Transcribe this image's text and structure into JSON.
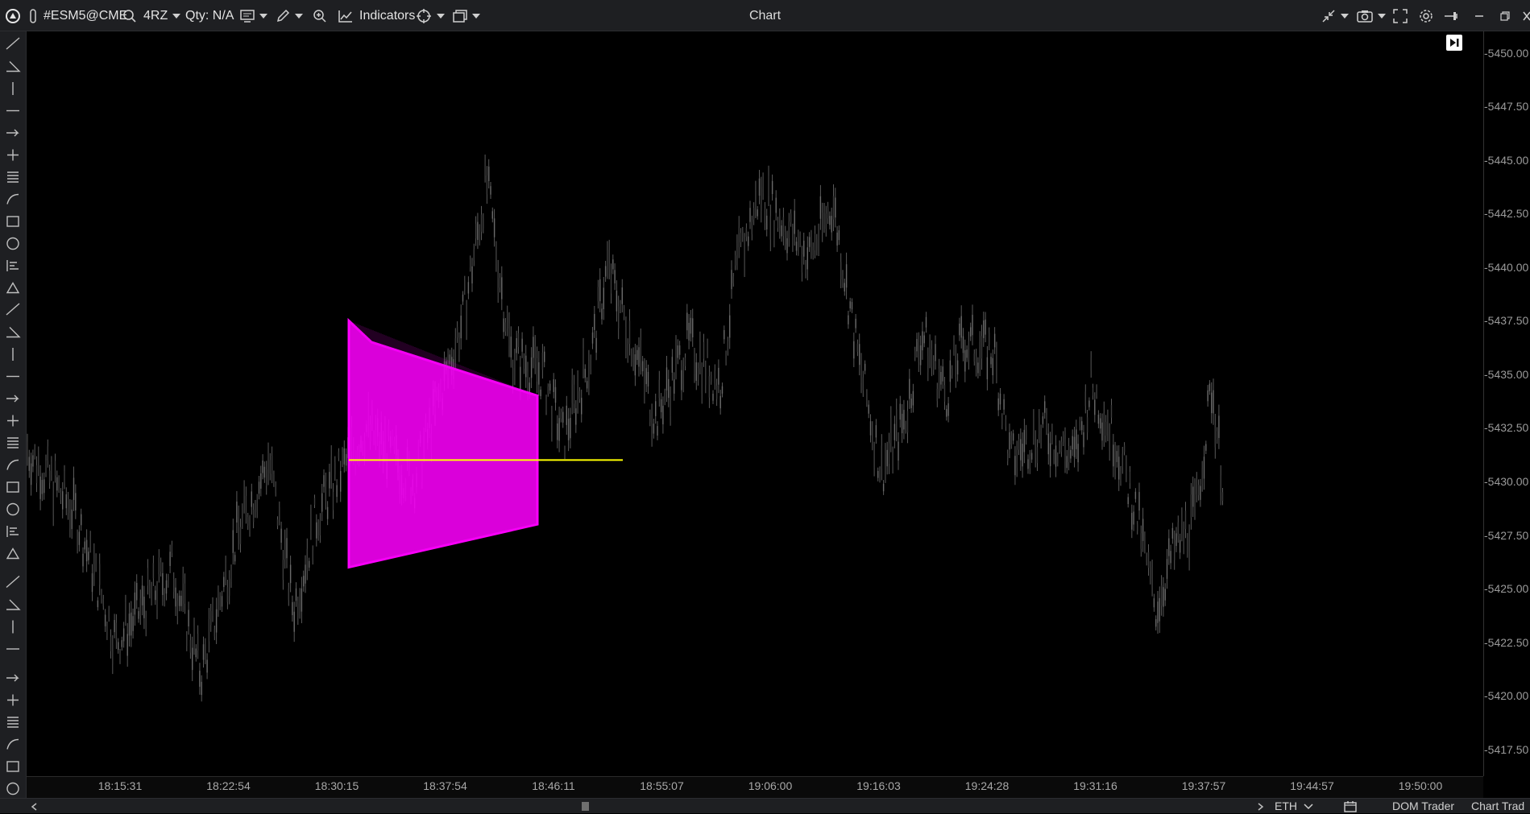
{
  "toolbar": {
    "symbol": "#ESM5@CME",
    "timeframe": "4RZ",
    "qty": "Qty: N/A",
    "indicators_label": "Indicators"
  },
  "window": {
    "title": "Chart"
  },
  "left_tools": [
    "drag-handle-icon",
    "line-tool-icon",
    "angle-tool-icon",
    "vertical-line-icon",
    "horizontal-ray-icon",
    "arrow-ray-icon",
    "crosshair-icon",
    "horizontal-lines-icon",
    "curve-tool-icon",
    "angle-fan-icon",
    "spiral-icon",
    "ruler-icon",
    "parallel-channel-icon",
    "triangle-icon",
    "rectangle-icon",
    "circle-icon",
    "fib-retracement-icon",
    "fib-extension-icon",
    "fib-levels-icon",
    "pitchfork-icon",
    "regression-icon",
    "gann-icon",
    "dotted-rect-icon",
    "dotted-vertical-icon",
    "text-tool-icon",
    "tag-icon",
    "label-icon",
    "callout-icon",
    "dot-marker-icon",
    "diamond-marker-icon",
    "square-marker-icon",
    "arrow-up-marker-icon",
    "arrow-down-marker-icon",
    "sort-icon"
  ],
  "chart": {
    "play_button": "jump-to-end-icon"
  },
  "chart_data": {
    "type": "candlestick",
    "symbol": "#ESM5@CME",
    "y_ticks": [
      "5450.00",
      "5447.50",
      "5445.00",
      "5442.50",
      "5440.00",
      "5437.50",
      "5435.00",
      "5432.50",
      "5430.00",
      "5427.50",
      "5425.00",
      "5422.50",
      "5420.00",
      "5417.50"
    ],
    "y_range": [
      5416.25,
      5451.0
    ],
    "x_ticks": [
      "18:15:31",
      "18:22:54",
      "18:30:15",
      "18:37:54",
      "18:46:11",
      "18:55:07",
      "19:06:00",
      "19:16:03",
      "19:24:28",
      "19:31:16",
      "19:37:57",
      "19:44:57",
      "19:50:00"
    ],
    "price_path": [
      {
        "x": 0,
        "y": 5431.5
      },
      {
        "x": 60,
        "y": 5428.5
      },
      {
        "x": 110,
        "y": 5422.5
      },
      {
        "x": 140,
        "y": 5424.0
      },
      {
        "x": 180,
        "y": 5426.0
      },
      {
        "x": 215,
        "y": 5421.0
      },
      {
        "x": 260,
        "y": 5427.5
      },
      {
        "x": 300,
        "y": 5431.0
      },
      {
        "x": 330,
        "y": 5424.0
      },
      {
        "x": 360,
        "y": 5428.5
      },
      {
        "x": 420,
        "y": 5432.5
      },
      {
        "x": 480,
        "y": 5430.0
      },
      {
        "x": 540,
        "y": 5437.5
      },
      {
        "x": 570,
        "y": 5444.0
      },
      {
        "x": 600,
        "y": 5436.0
      },
      {
        "x": 640,
        "y": 5435.0
      },
      {
        "x": 665,
        "y": 5432.0
      },
      {
        "x": 700,
        "y": 5436.0
      },
      {
        "x": 720,
        "y": 5440.0
      },
      {
        "x": 760,
        "y": 5435.5
      },
      {
        "x": 780,
        "y": 5433.0
      },
      {
        "x": 820,
        "y": 5436.5
      },
      {
        "x": 860,
        "y": 5434.5
      },
      {
        "x": 880,
        "y": 5440.0
      },
      {
        "x": 910,
        "y": 5443.5
      },
      {
        "x": 940,
        "y": 5442.0
      },
      {
        "x": 970,
        "y": 5440.5
      },
      {
        "x": 1000,
        "y": 5443.0
      },
      {
        "x": 1030,
        "y": 5436.0
      },
      {
        "x": 1060,
        "y": 5430.5
      },
      {
        "x": 1090,
        "y": 5433.0
      },
      {
        "x": 1110,
        "y": 5437.0
      },
      {
        "x": 1140,
        "y": 5434.0
      },
      {
        "x": 1160,
        "y": 5436.5
      },
      {
        "x": 1200,
        "y": 5436.0
      },
      {
        "x": 1220,
        "y": 5431.0
      },
      {
        "x": 1260,
        "y": 5432.5
      },
      {
        "x": 1300,
        "y": 5431.0
      },
      {
        "x": 1320,
        "y": 5434.5
      },
      {
        "x": 1350,
        "y": 5432.0
      },
      {
        "x": 1380,
        "y": 5428.0
      },
      {
        "x": 1400,
        "y": 5424.0
      },
      {
        "x": 1420,
        "y": 5426.5
      },
      {
        "x": 1450,
        "y": 5428.5
      },
      {
        "x": 1470,
        "y": 5434.5
      },
      {
        "x": 1484,
        "y": 5430.0
      }
    ],
    "drawings": [
      {
        "kind": "polygon",
        "color": "#ff00ff",
        "points": [
          [
            0,
            5437.5
          ],
          [
            0.12,
            5436.5
          ],
          [
            1,
            5434.0
          ],
          [
            1,
            5428.0
          ],
          [
            0,
            5426.0
          ]
        ]
      },
      {
        "kind": "horizontal-segment",
        "color": "#ffff00",
        "y": 5431.0
      }
    ]
  },
  "bottom": {
    "session": "ETH",
    "dom_trader": "DOM Trader",
    "chart_trader": "Chart Trad"
  }
}
